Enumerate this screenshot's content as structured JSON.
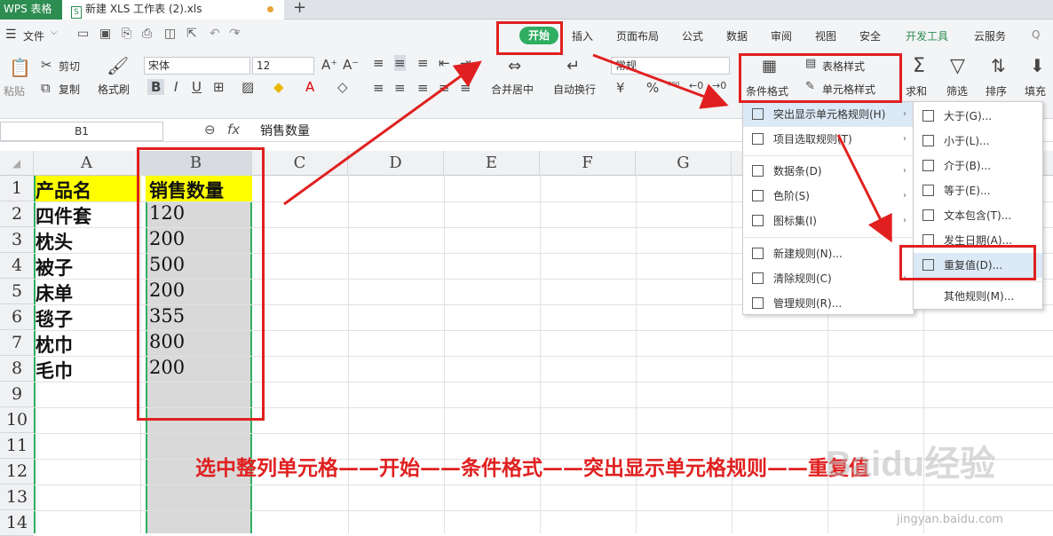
{
  "tabbar": {
    "app": "WPS 表格",
    "doc": "新建 XLS 工作表 (2).xls",
    "new_tab": "+"
  },
  "menu": {
    "file": "文件",
    "tabs": [
      "开始",
      "插入",
      "页面布局",
      "公式",
      "数据",
      "审阅",
      "视图",
      "安全",
      "开发工具",
      "云服务"
    ],
    "search": "Q"
  },
  "ribbon": {
    "paste": "粘贴",
    "cut": "剪切",
    "copy": "复制",
    "format_painter": "格式刷",
    "font": "宋体",
    "size": "12",
    "merge": "合并居中",
    "wrap": "自动换行",
    "number_format": "常规",
    "cond_format": "条件格式",
    "table_style": "表格样式",
    "cell_style": "单元格样式",
    "sum": "求和",
    "filter": "筛选",
    "sort": "排序",
    "fill": "填充"
  },
  "formula_bar": {
    "name_box": "B1",
    "fx": "fx",
    "value": "销售数量"
  },
  "columns": [
    "A",
    "B",
    "C",
    "D",
    "E",
    "F",
    "G"
  ],
  "rows": [
    "1",
    "2",
    "3",
    "4",
    "5",
    "6",
    "7",
    "8",
    "9",
    "10",
    "11",
    "12",
    "13",
    "14"
  ],
  "table": {
    "headers": [
      "产品名",
      "销售数量"
    ],
    "data": [
      [
        "四件套",
        "120"
      ],
      [
        "枕头",
        "200"
      ],
      [
        "被子",
        "500"
      ],
      [
        "床单",
        "200"
      ],
      [
        "毯子",
        "355"
      ],
      [
        "枕巾",
        "800"
      ],
      [
        "毛巾",
        "200"
      ]
    ]
  },
  "cf_menu": {
    "items": [
      "突出显示单元格规则(H)",
      "项目选取规则(T)",
      "数据条(D)",
      "色阶(S)",
      "图标集(I)",
      "新建规则(N)...",
      "清除规则(C)",
      "管理规则(R)..."
    ]
  },
  "sub_menu": {
    "items": [
      "大于(G)...",
      "小于(L)...",
      "介于(B)...",
      "等于(E)...",
      "文本包含(T)...",
      "发生日期(A)...",
      "重复值(D)...",
      "其他规则(M)..."
    ]
  },
  "caption": "选中整列单元格——开始——条件格式——突出显示单元格规则——重复值",
  "watermark": "Baidu经验",
  "watermark_url": "jingyan.baidu.com",
  "colors": {
    "accent": "#2fae62",
    "header_yellow": "#ffff00",
    "annotation_red": "#e02020",
    "selection_gray": "#d9d9d9"
  }
}
